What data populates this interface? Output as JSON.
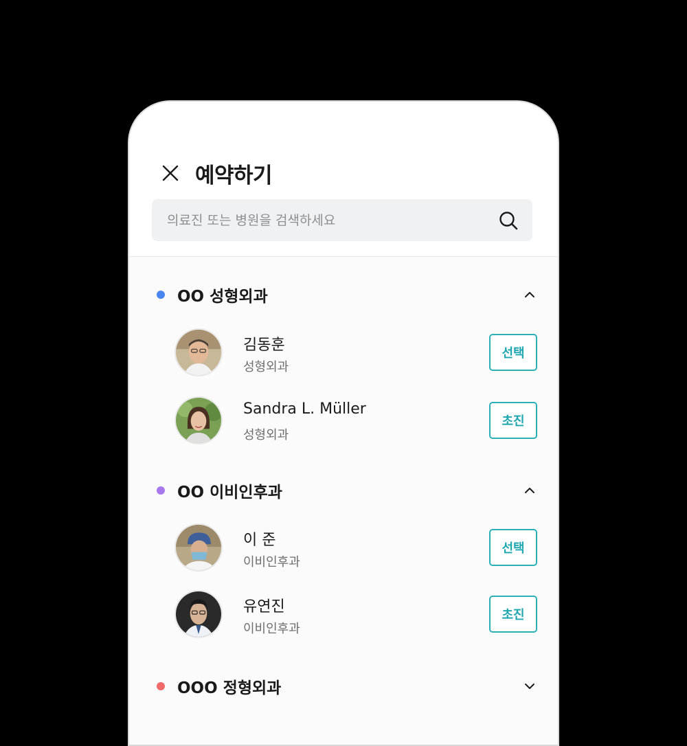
{
  "header": {
    "title": "예약하기"
  },
  "search": {
    "placeholder": "의료진 또는 병원을 검색하세요",
    "value": ""
  },
  "sections": [
    {
      "title": "OO 성형외과",
      "dot_color": "#4a86f0",
      "expanded": true,
      "doctors": [
        {
          "name": "김동훈",
          "dept": "성형외과",
          "button": "선택"
        },
        {
          "name": "Sandra L. Müller",
          "dept": "성형외과",
          "button": "초진"
        }
      ]
    },
    {
      "title": "OO 이비인후과",
      "dot_color": "#a878ee",
      "expanded": true,
      "doctors": [
        {
          "name": "이 준",
          "dept": "이비인후과",
          "button": "선택"
        },
        {
          "name": "유연진",
          "dept": "이비인후과",
          "button": "초진"
        }
      ]
    },
    {
      "title": "OOO 정형외과",
      "dot_color": "#f06a6a",
      "expanded": false,
      "doctors": []
    }
  ],
  "colors": {
    "accent": "#2bb0b8"
  }
}
